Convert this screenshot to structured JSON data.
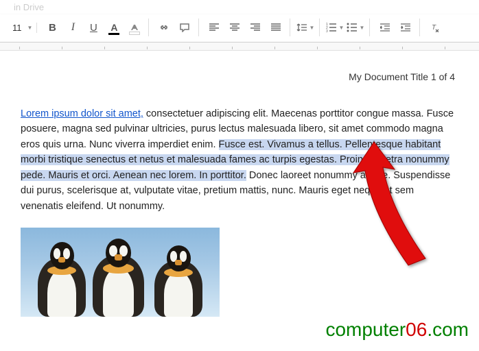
{
  "title_bar": "in Drive",
  "toolbar": {
    "font_size": "11",
    "bold": "B",
    "italic": "I",
    "underline": "U",
    "text_color": "A"
  },
  "document": {
    "header": "My Document Title 1 of 4",
    "para_link": "Lorem ipsum dolor sit amet,",
    "para_before": " consectetuer adipiscing elit. Maecenas porttitor congue massa. Fusce posuere, magna sed pulvinar ultricies, purus lectus malesuada libero, sit amet commodo magna eros quis urna. Nunc viverra imperdiet enim. ",
    "para_selected": "Fusce est. Vivamus a tellus. Pellentesque habitant morbi tristique senectus et netus et malesuada fames ac turpis egestas. Proin pharetra nonummy pede. Mauris et orci. Aenean nec lorem. In porttitor.",
    "para_after": " Donec laoreet nonummy augue. Suspendisse dui purus, scelerisque at, vulputate vitae, pretium mattis, nunc. Mauris eget neque at sem venenatis eleifend. Ut nonummy."
  },
  "watermark": {
    "part1": "computer",
    "part2": "06",
    "part3": ".com"
  }
}
